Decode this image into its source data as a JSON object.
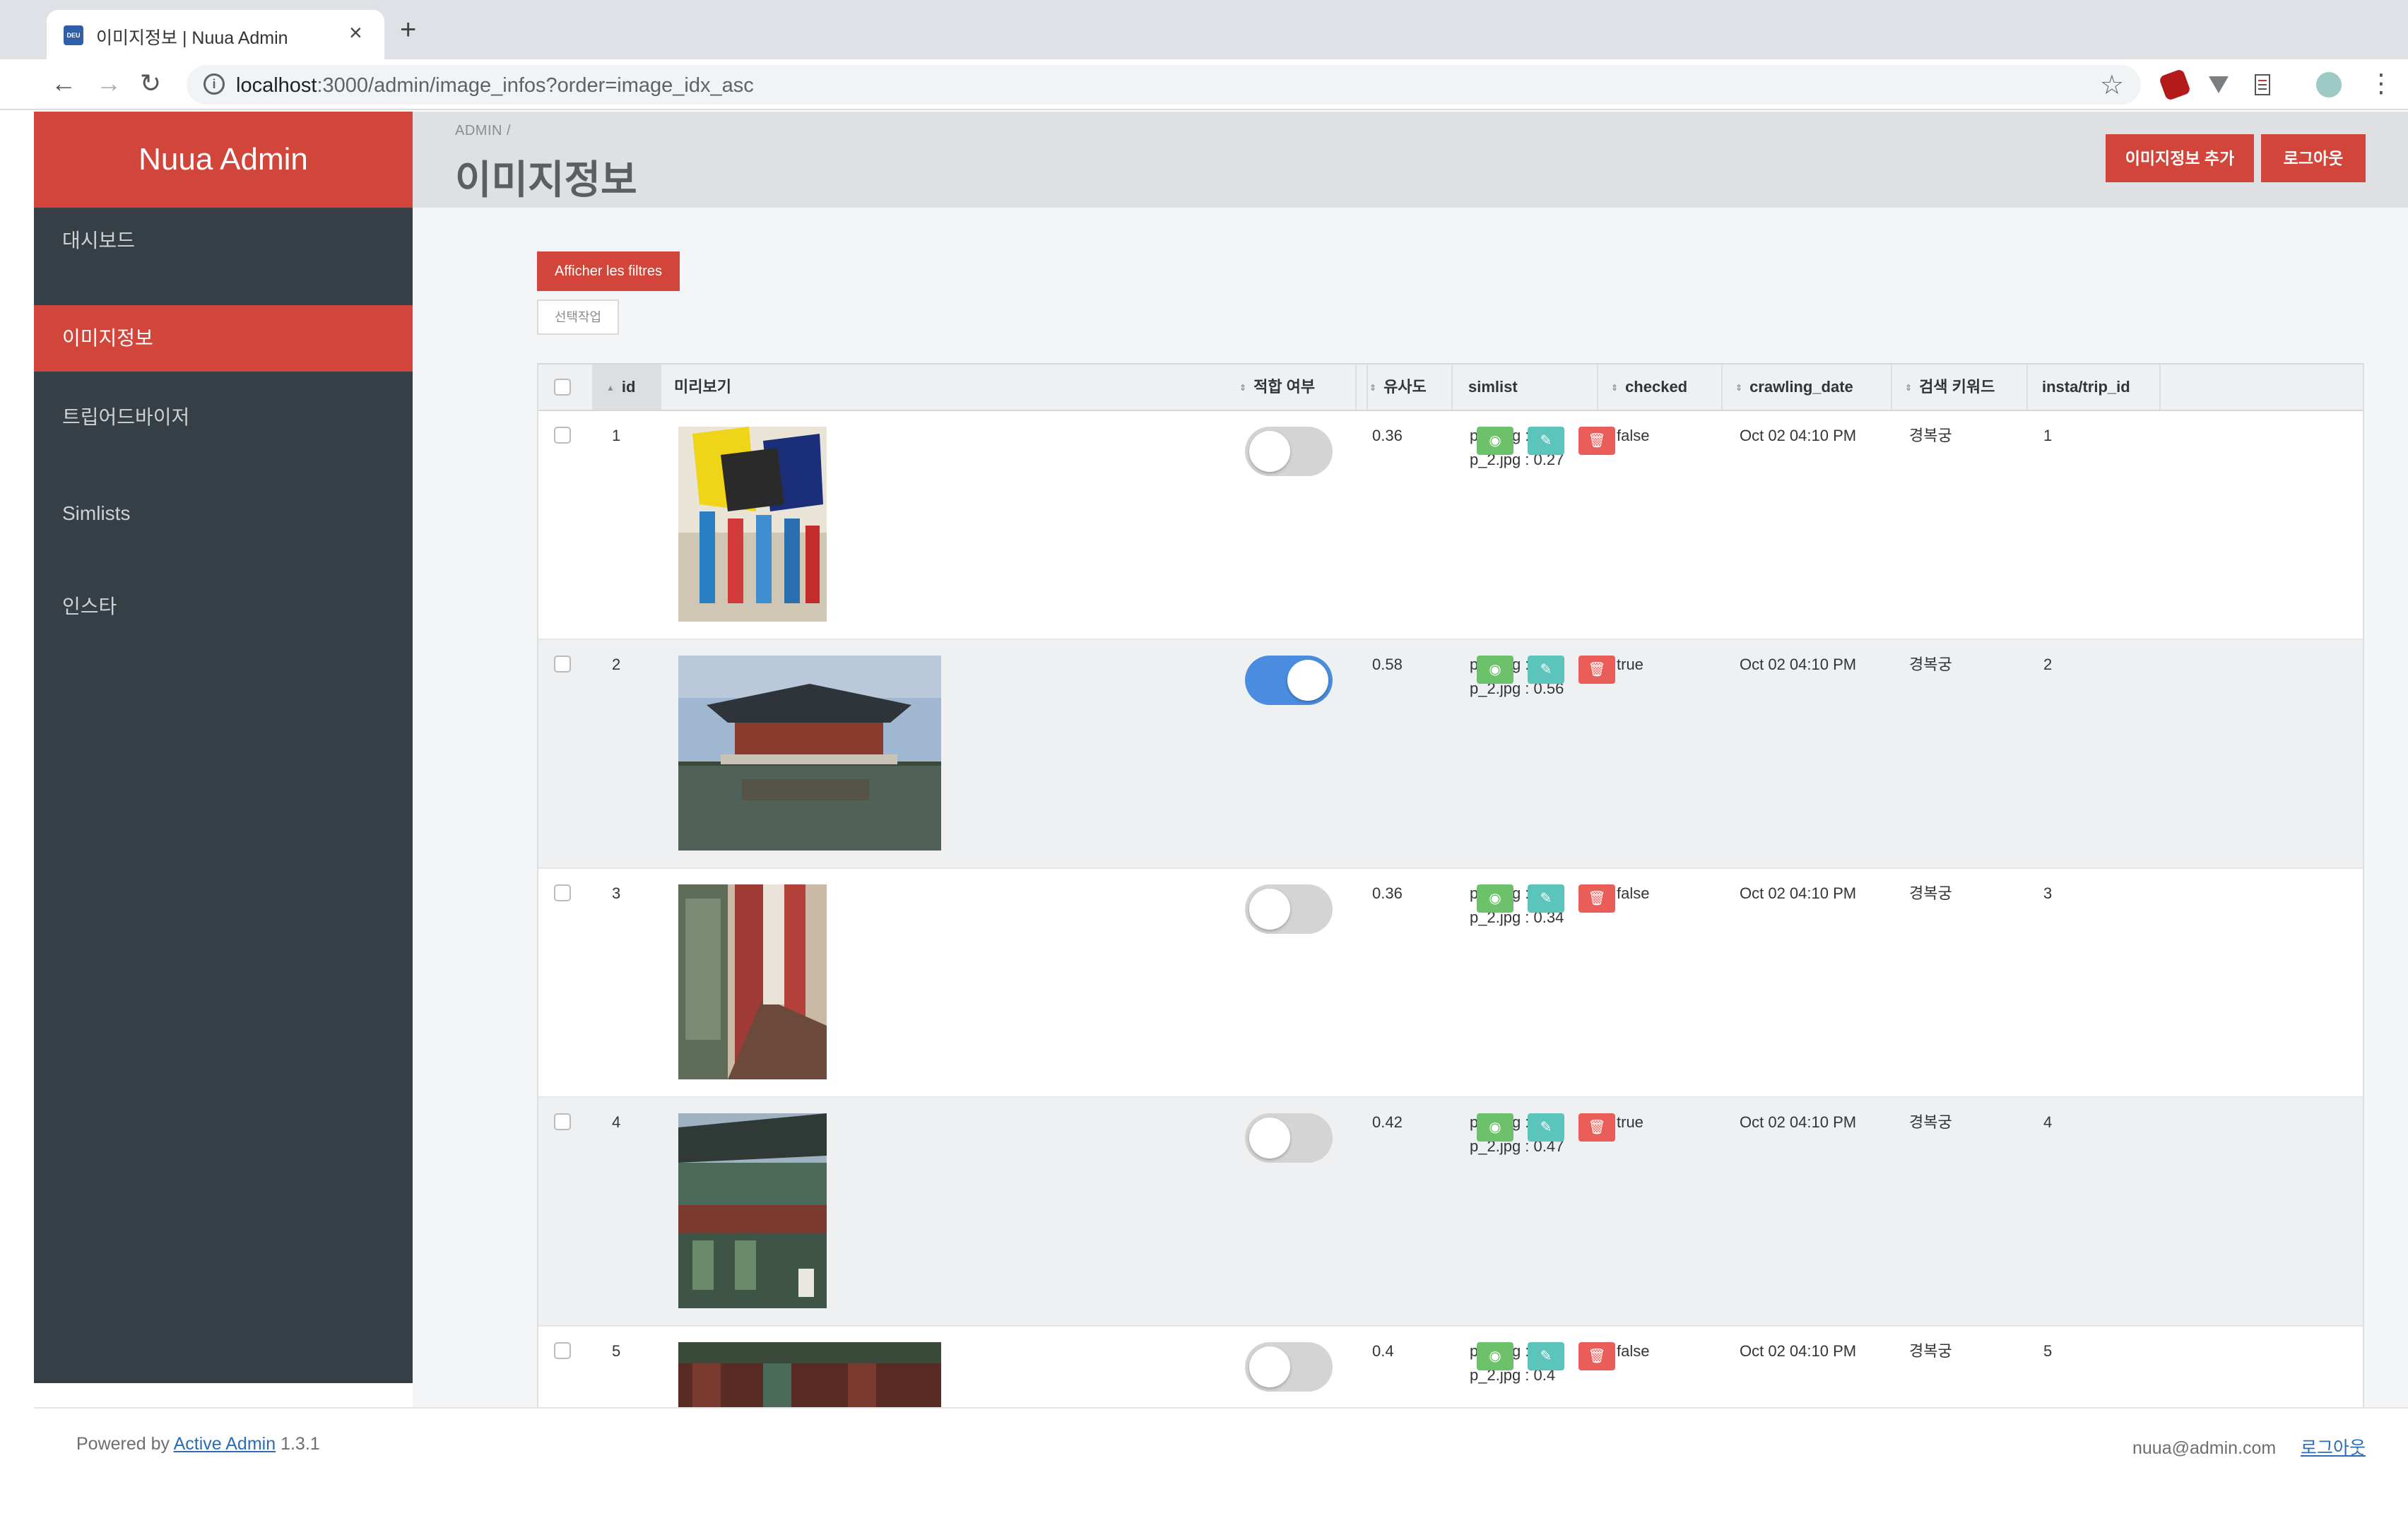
{
  "browser": {
    "tab_title": "이미지정보 | Nuua Admin",
    "url_host": "localhost",
    "url_rest": ":3000/admin/image_infos?order=image_idx_asc"
  },
  "brand": {
    "title": "Nuua Admin"
  },
  "header": {
    "breadcrumb": "ADMIN /",
    "title": "이미지정보",
    "add_button": "이미지정보 추가",
    "logout_button": "로그아웃"
  },
  "sidebar": {
    "items": [
      {
        "label": "대시보드",
        "active": false
      },
      {
        "label": "이미지정보",
        "active": true
      },
      {
        "label": "트립어드바이저",
        "active": false
      },
      {
        "label": "Simlists",
        "active": false
      },
      {
        "label": "인스타",
        "active": false
      }
    ]
  },
  "filters_button": "Afficher les filtres",
  "batch_button": "선택작업",
  "table": {
    "columns": [
      "id",
      "미리보기",
      "적합 여부",
      "유사도",
      "simlist",
      "checked",
      "crawling_date",
      "검색 키워드",
      "insta/trip_id"
    ],
    "rows": [
      {
        "id": "1",
        "suitable": false,
        "similarity": "0.36",
        "sim1": "p_1.jpg : 0.37",
        "sim2": "p_2.jpg : 0.27",
        "checked": "false",
        "date": "Oct 02 04:10 PM",
        "keyword": "경복궁",
        "ref_id": "1",
        "thumb_desc": "guards-with-flags"
      },
      {
        "id": "2",
        "suitable": true,
        "similarity": "0.58",
        "sim1": "p_1.jpg : 0.58",
        "sim2": "p_2.jpg : 0.56",
        "checked": "true",
        "date": "Oct 02 04:10 PM",
        "keyword": "경복궁",
        "ref_id": "2",
        "thumb_desc": "pavilion-on-pond"
      },
      {
        "id": "3",
        "suitable": false,
        "similarity": "0.36",
        "sim1": "p_1.jpg : 0.33",
        "sim2": "p_2.jpg : 0.34",
        "checked": "false",
        "date": "Oct 02 04:10 PM",
        "keyword": "경복궁",
        "ref_id": "3",
        "thumb_desc": "red-corridor"
      },
      {
        "id": "4",
        "suitable": false,
        "similarity": "0.42",
        "sim1": "p_1.jpg : 0.48",
        "sim2": "p_2.jpg : 0.47",
        "checked": "true",
        "date": "Oct 02 04:10 PM",
        "keyword": "경복궁",
        "ref_id": "4",
        "thumb_desc": "palace-eaves"
      },
      {
        "id": "5",
        "suitable": false,
        "similarity": "0.4",
        "sim1": "p_1.jpg : 0.39",
        "sim2": "p_2.jpg : 0.4",
        "checked": "false",
        "date": "Oct 02 04:10 PM",
        "keyword": "경복궁",
        "ref_id": "5",
        "thumb_desc": "painted-beams"
      }
    ]
  },
  "footer": {
    "powered_prefix": "Powered by",
    "link": "Active Admin",
    "version": "1.3.1",
    "email": "nuua@admin.com",
    "logout": "로그아웃"
  },
  "colors": {
    "accent": "#d1453b",
    "sidebar": "#363f45",
    "toggle_on": "#4a8de0",
    "view": "#6cc16a",
    "edit": "#5bc4bb",
    "delete": "#ea5d59"
  }
}
